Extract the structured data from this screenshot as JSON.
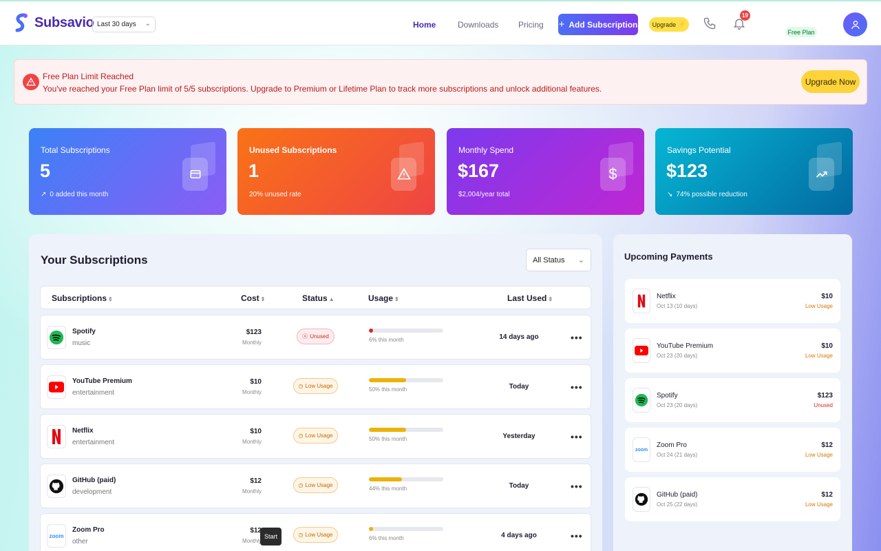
{
  "brand": {
    "name": "Subsavio"
  },
  "range_select": {
    "value": "Last 30 days"
  },
  "nav": {
    "home": "Home",
    "downloads": "Downloads",
    "pricing": "Pricing"
  },
  "header": {
    "add_label": "Add Subscription",
    "upgrade_label": "Upgrade",
    "notif_count": "19",
    "plan_label": "Free Plan"
  },
  "alert": {
    "title": "Free Plan Limit Reached",
    "message": "You've reached your Free Plan limit of 5/5 subscriptions. Upgrade to Premium or Lifetime Plan to track more subscriptions and unlock additional features.",
    "button": "Upgrade Now"
  },
  "stats": [
    {
      "label": "Total Subscriptions",
      "value": "5",
      "sub": "0 added this month",
      "icon": "credit-card-icon"
    },
    {
      "label": "Unused Subscriptions",
      "value": "1",
      "sub": "20% unused rate",
      "icon": "warning-icon"
    },
    {
      "label": "Monthly Spend",
      "value": "$167",
      "sub": "$2,004/year total",
      "icon": "dollar-icon"
    },
    {
      "label": "Savings Potential",
      "value": "$123",
      "sub": "74% possible reduction",
      "icon": "trend-up-icon"
    }
  ],
  "subs": {
    "title": "Your Subscriptions",
    "filter": "All Status",
    "columns": {
      "name": "Subscriptions",
      "cost": "Cost",
      "status": "Status",
      "usage": "Usage",
      "last": "Last Used"
    },
    "rows": [
      {
        "name": "Spotify",
        "category": "music",
        "cost": "$123",
        "period": "Monthly",
        "status": "Unused",
        "usage_pct": 6,
        "usage_label": "6% this month",
        "usage_color": "#dc2626",
        "last_used": "14 days ago"
      },
      {
        "name": "YouTube Premium",
        "category": "entertainment",
        "cost": "$10",
        "period": "Monthly",
        "status": "Low Usage",
        "usage_pct": 50,
        "usage_label": "50% this month",
        "usage_color": "#eab308",
        "last_used": "Today"
      },
      {
        "name": "Netflix",
        "category": "entertainment",
        "cost": "$10",
        "period": "Monthly",
        "status": "Low Usage",
        "usage_pct": 50,
        "usage_label": "50% this month",
        "usage_color": "#eab308",
        "last_used": "Yesterday"
      },
      {
        "name": "GitHub (paid)",
        "category": "development",
        "cost": "$12",
        "period": "Monthly",
        "status": "Low Usage",
        "usage_pct": 44,
        "usage_label": "44% this month",
        "usage_color": "#eab308",
        "last_used": "Today"
      },
      {
        "name": "Zoom Pro",
        "category": "other",
        "cost": "$12",
        "period": "Monthly",
        "status": "Low Usage",
        "usage_pct": 6,
        "usage_label": "6% this month",
        "usage_color": "#eab308",
        "last_used": "4 days ago"
      }
    ]
  },
  "tooltip": "Start",
  "upcoming": {
    "title": "Upcoming Payments",
    "items": [
      {
        "name": "Netflix",
        "date": "Oct 13 (10 days)",
        "amount": "$10",
        "status": "Low Usage",
        "status_color": "#d97706"
      },
      {
        "name": "YouTube Premium",
        "date": "Oct 23 (20 days)",
        "amount": "$10",
        "status": "Low Usage",
        "status_color": "#d97706"
      },
      {
        "name": "Spotify",
        "date": "Oct 23 (20 days)",
        "amount": "$123",
        "status": "Unused",
        "status_color": "#dc2626"
      },
      {
        "name": "Zoom Pro",
        "date": "Oct 24 (21 days)",
        "amount": "$12",
        "status": "Low Usage",
        "status_color": "#d97706"
      },
      {
        "name": "GitHub (paid)",
        "date": "Oct 25 (22 days)",
        "amount": "$12",
        "status": "Low Usage",
        "status_color": "#d97706"
      }
    ]
  },
  "logo_texts": {
    "zoom": "zoom"
  },
  "colors": {
    "brand": "#4b2bb0",
    "accent": "#7c3aed",
    "danger": "#ef4444",
    "warning": "#eab308"
  }
}
